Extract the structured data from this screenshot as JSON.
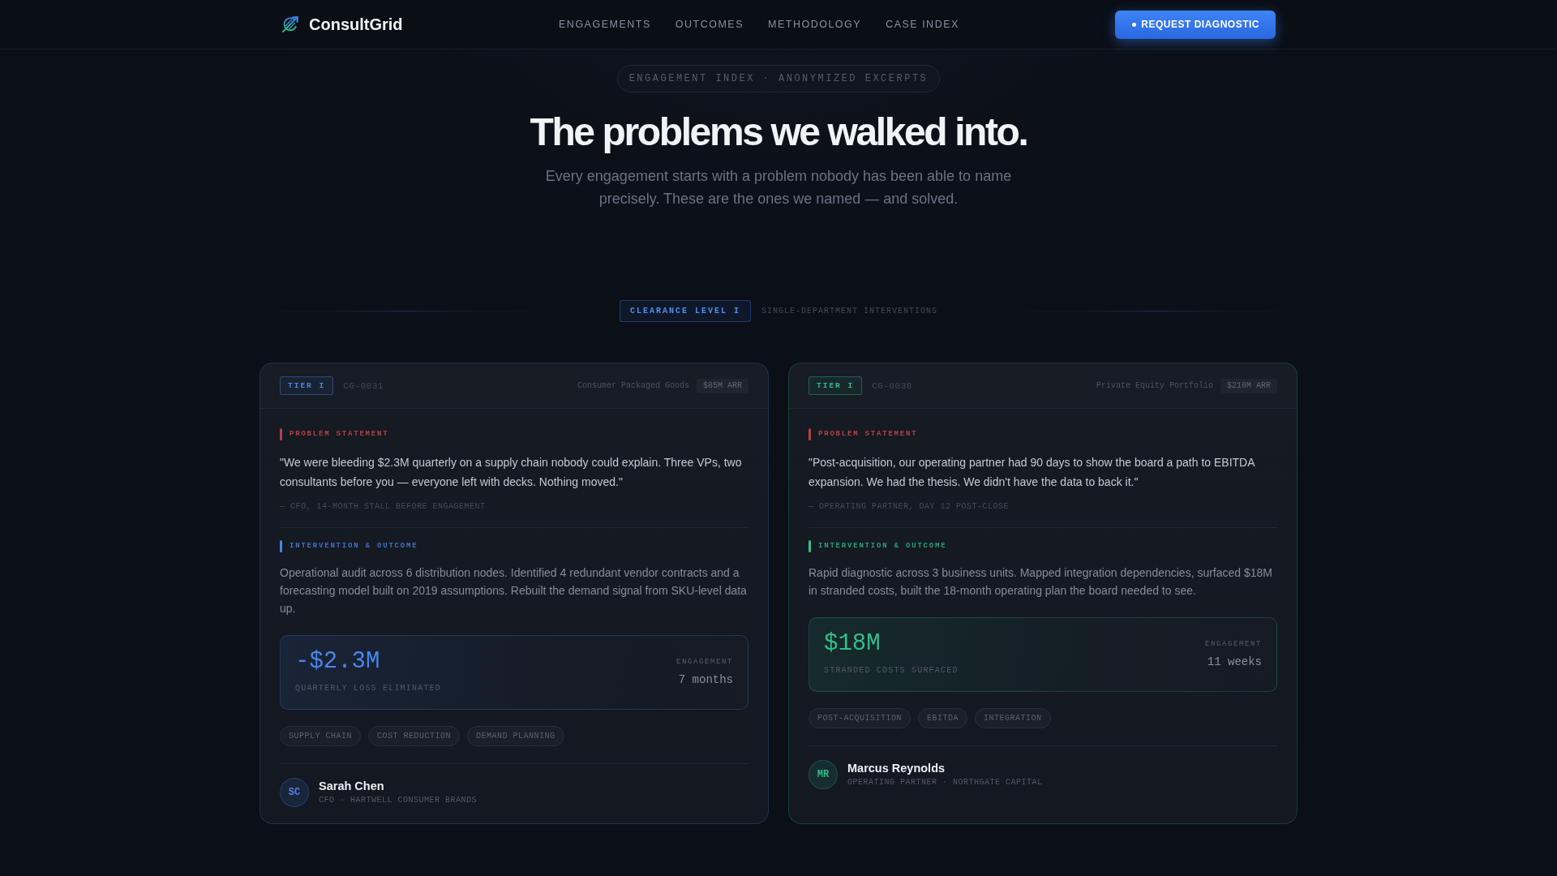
{
  "nav": {
    "brand": "ConsultGrid",
    "links": [
      "ENGAGEMENTS",
      "OUTCOMES",
      "METHODOLOGY",
      "CASE INDEX"
    ],
    "cta": "REQUEST DIAGNOSTIC"
  },
  "hero": {
    "eyebrow": "ENGAGEMENT INDEX · ANONYMIZED EXCERPTS",
    "title": "The problems we walked into.",
    "subtitle": "Every engagement starts with a problem nobody has been able to name precisely. These are the ones we named — and solved."
  },
  "section": {
    "clearance": "CLEARANCE LEVEL I",
    "scope": "SINGLE-DEPARTMENT INTERVENTIONS"
  },
  "cases": [
    {
      "color": "#4a86e8",
      "tier": "TIER I",
      "case_id": "CG-0031",
      "industry": "Consumer Packaged Goods",
      "arr": "$85M ARR",
      "problem_label": "PROBLEM STATEMENT",
      "quote": "\"We were bleeding $2.3M quarterly on a supply chain nobody could explain. Three VPs, two consultants before you — everyone left with decks. Nothing moved.\"",
      "attribution": "— CFO, 14-MONTH STALL BEFORE ENGAGEMENT",
      "outcome_label": "INTERVENTION & OUTCOME",
      "outcome": "Operational audit across 6 distribution nodes. Identified 4 redundant vendor contracts and a forecasting model built on 2019 assumptions. Rebuilt the demand signal from SKU-level data up.",
      "metric": {
        "value": "-$2.3M",
        "label": "QUARTERLY LOSS ELIMINATED",
        "duration_label": "ENGAGEMENT",
        "duration": "7 months"
      },
      "tags": [
        "SUPPLY CHAIN",
        "COST REDUCTION",
        "DEMAND PLANNING"
      ],
      "client": {
        "initials": "SC",
        "name": "Sarah Chen",
        "role": "CFO · HARTWELL CONSUMER BRANDS"
      }
    },
    {
      "color": "#2fbf88",
      "tier": "TIER I",
      "case_id": "CG-0038",
      "industry": "Private Equity Portfolio",
      "arr": "$210M ARR",
      "problem_label": "PROBLEM STATEMENT",
      "quote": "\"Post-acquisition, our operating partner had 90 days to show the board a path to EBITDA expansion. We had the thesis. We didn't have the data to back it.\"",
      "attribution": "— OPERATING PARTNER, DAY 12 POST-CLOSE",
      "outcome_label": "INTERVENTION & OUTCOME",
      "outcome": "Rapid diagnostic across 3 business units. Mapped integration dependencies, surfaced $18M in stranded costs, built the 18-month operating plan the board needed to see.",
      "metric": {
        "value": "$18M",
        "label": "STRANDED COSTS SURFACED",
        "duration_label": "ENGAGEMENT",
        "duration": "11 weeks"
      },
      "tags": [
        "POST-ACQUISITION",
        "EBITDA",
        "INTEGRATION"
      ],
      "client": {
        "initials": "MR",
        "name": "Marcus Reynolds",
        "role": "OPERATING PARTNER · NORTHGATE CAPITAL"
      }
    }
  ]
}
